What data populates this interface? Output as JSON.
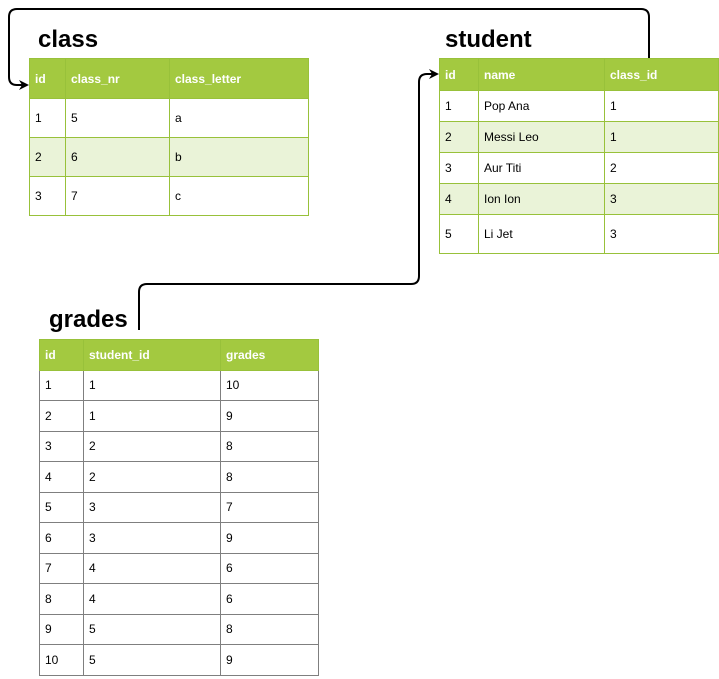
{
  "tables": {
    "class": {
      "title": "class",
      "headers": [
        "id",
        "class_nr",
        "class_letter"
      ],
      "rows": [
        [
          "1",
          "5",
          "a"
        ],
        [
          "2",
          "6",
          "b"
        ],
        [
          "3",
          "7",
          "c"
        ]
      ]
    },
    "student": {
      "title": "student",
      "headers": [
        "id",
        "name",
        "class_id"
      ],
      "rows": [
        [
          "1",
          "Pop Ana",
          "1"
        ],
        [
          "2",
          "Messi Leo",
          "1"
        ],
        [
          "3",
          "Aur Titi",
          "2"
        ],
        [
          "4",
          "Ion Ion",
          "3"
        ],
        [
          "5",
          "Li Jet",
          "3"
        ]
      ]
    },
    "grades": {
      "title": "grades",
      "headers": [
        "id",
        "student_id",
        "grades"
      ],
      "rows": [
        [
          "1",
          "1",
          "10"
        ],
        [
          "2",
          "1",
          "9"
        ],
        [
          "3",
          "2",
          "8"
        ],
        [
          "4",
          "2",
          "8"
        ],
        [
          "5",
          "3",
          "7"
        ],
        [
          "6",
          "3",
          "9"
        ],
        [
          "7",
          "4",
          "6"
        ],
        [
          "8",
          "4",
          "6"
        ],
        [
          "9",
          "5",
          "8"
        ],
        [
          "10",
          "5",
          "9"
        ]
      ]
    }
  },
  "colors": {
    "header": "#a3c940",
    "stripe": "#eaf3d8",
    "border": "#98c13a"
  }
}
